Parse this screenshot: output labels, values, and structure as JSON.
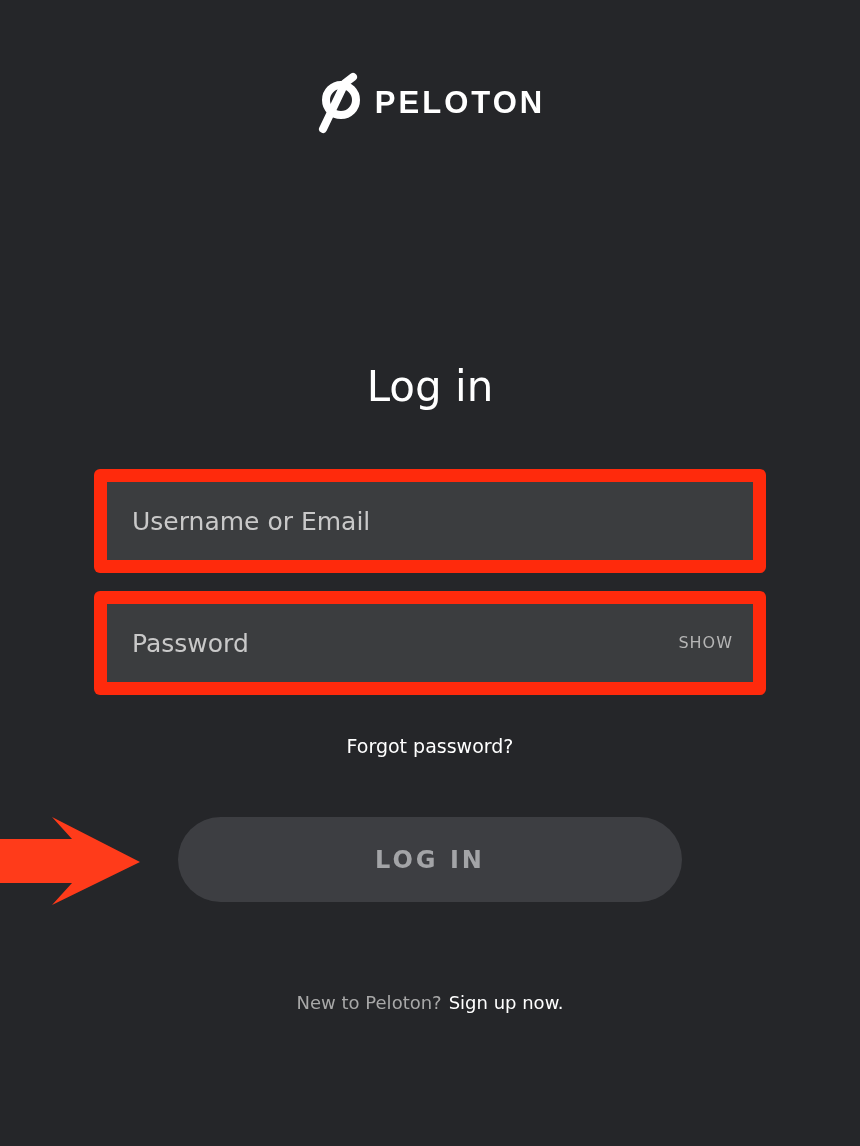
{
  "logo": {
    "text": "PELOTON"
  },
  "heading": "Log in",
  "fields": [
    {
      "placeholder": "Username or Email",
      "highlighted": true
    },
    {
      "placeholder": "Password",
      "highlighted": true,
      "toggle": "SHOW"
    }
  ],
  "forgot_link": "Forgot password?",
  "login_button": {
    "label": "LOG IN",
    "pointed_at": true
  },
  "signup": {
    "prompt": "New to Peloton?",
    "link": "Sign up now."
  }
}
